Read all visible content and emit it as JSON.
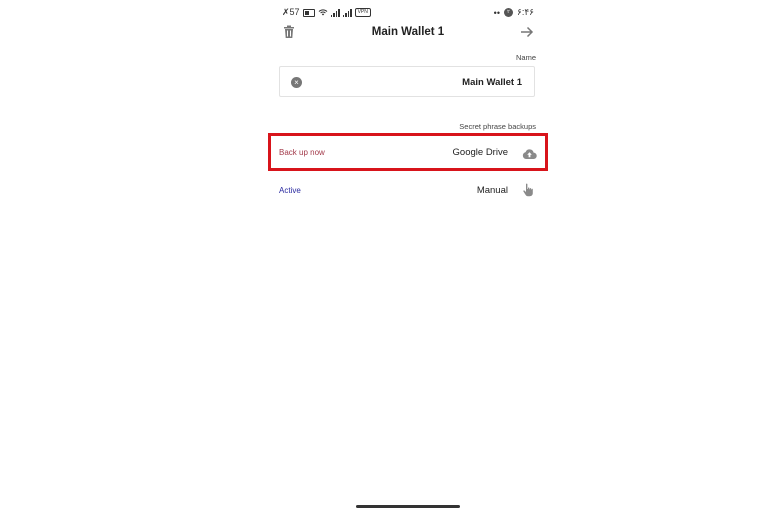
{
  "status_bar": {
    "left_text": "✗57",
    "right_badge": "۲",
    "clock": "۶:۴۶",
    "vpn_label": "VPN",
    "dots": "••"
  },
  "header": {
    "title": "Main Wallet 1",
    "left_icon": "trash-icon",
    "right_icon": "arrow-right-icon"
  },
  "name_section": {
    "label": "Name",
    "value": "Main Wallet 1"
  },
  "backups": {
    "label": "Secret phrase backups",
    "items": [
      {
        "status": "Back up now",
        "service": "Google Drive",
        "icon": "cloud-upload-icon",
        "status_color": "#a33a4a"
      },
      {
        "status": "Active",
        "service": "Manual",
        "icon": "hand-pointer-icon",
        "status_color": "#2a2aa0"
      }
    ]
  },
  "colors": {
    "highlight": "#d8141b",
    "icon_gray": "#8a8a8a"
  }
}
